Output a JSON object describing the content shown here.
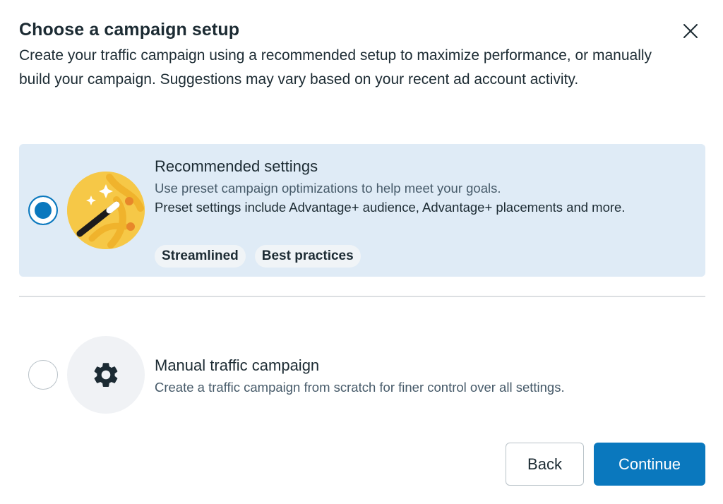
{
  "dialog": {
    "title": "Choose a campaign setup",
    "description": "Create your traffic campaign using a recommended setup to maximize performance, or manually build your campaign. Suggestions may vary based on your recent ad account activity.",
    "close_icon": "close-icon"
  },
  "options": {
    "recommended": {
      "title": "Recommended settings",
      "description": "Use preset campaign optimizations to help meet your goals.",
      "details": "Preset settings include Advantage+ audience, Advantage+ placements and more.",
      "tags": [
        "Streamlined",
        "Best practices"
      ],
      "selected": true,
      "icon": "magic-wand-icon"
    },
    "manual": {
      "title": "Manual traffic campaign",
      "description": "Create a traffic campaign from scratch for finer control over all settings.",
      "selected": false,
      "icon": "gear-icon"
    }
  },
  "buttons": {
    "back": "Back",
    "continue": "Continue"
  },
  "colors": {
    "accent": "#0a78be",
    "selected_bg": "#dfebf6",
    "text": "#1c2b33",
    "secondary_text": "#465a69",
    "illustration_yellow": "#f6c847"
  }
}
